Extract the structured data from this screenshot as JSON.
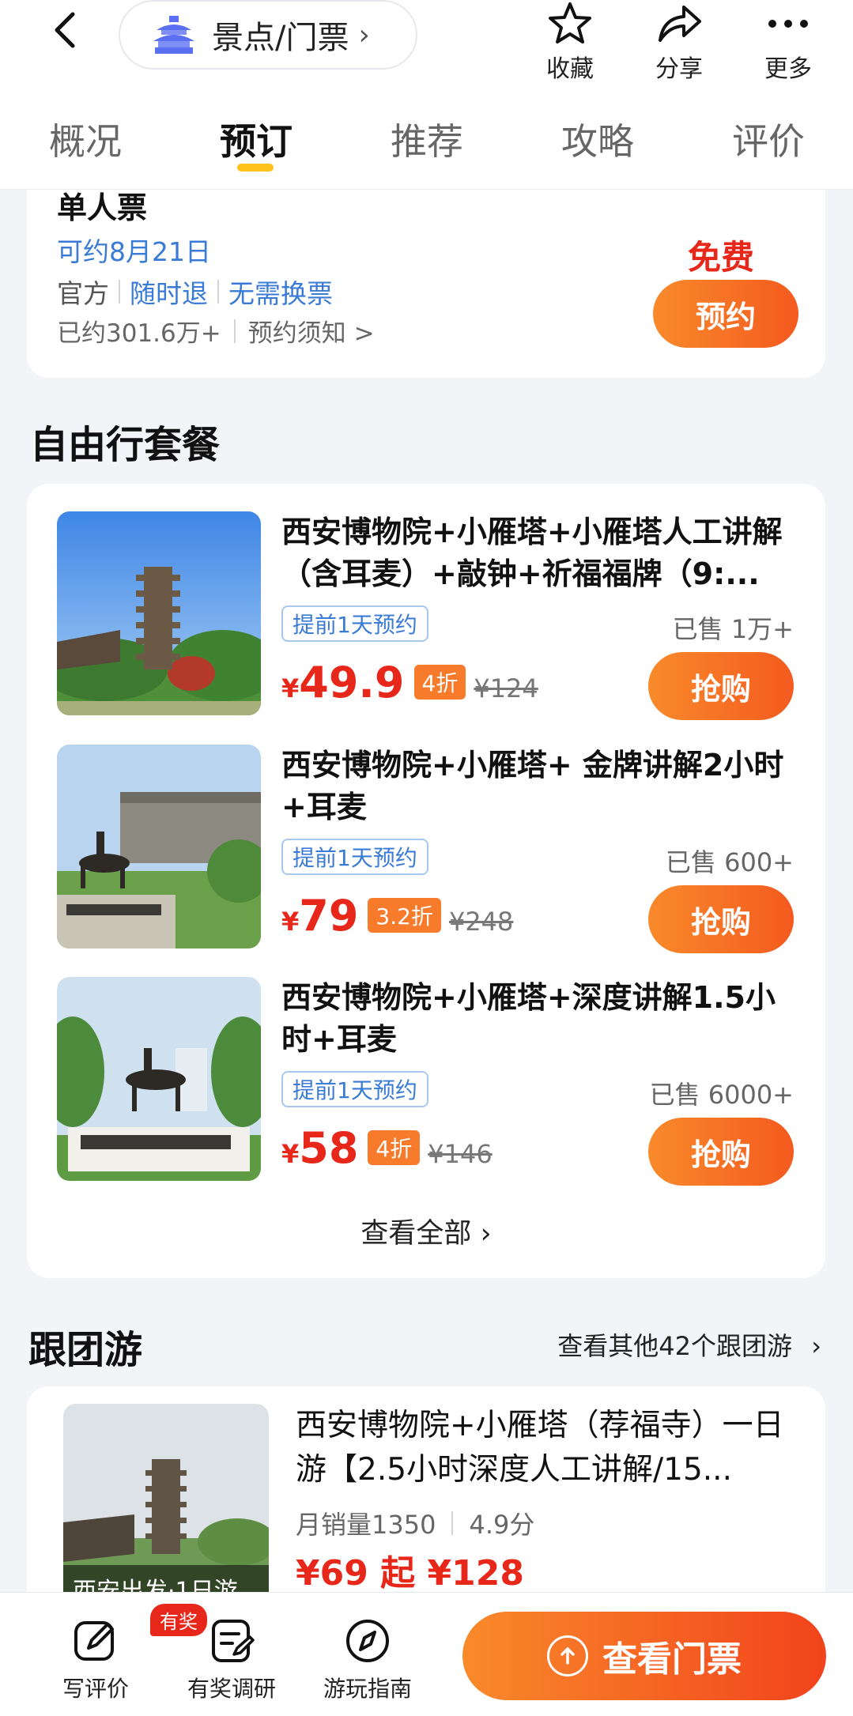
{
  "header": {
    "pill_label": "景点/门票",
    "actions": [
      {
        "label": "收藏",
        "icon": "star-icon"
      },
      {
        "label": "分享",
        "icon": "share-icon"
      },
      {
        "label": "更多",
        "icon": "more-icon"
      }
    ]
  },
  "tabs": [
    "概况",
    "预订",
    "推荐",
    "攻略",
    "评价"
  ],
  "active_tab": "预订",
  "ticket": {
    "title": "单人票",
    "date": "可约8月21日",
    "tag_official": "官方",
    "tag_refund": "随时退",
    "tag_noexchange": "无需换票",
    "booked": "已约301.6万+",
    "notice": "预约须知 >",
    "price": "免费",
    "button": "预约"
  },
  "packages_section": {
    "title": "自由行套餐",
    "items": [
      {
        "name": "西安博物院+小雁塔+小雁塔人工讲解（含耳麦）+敲钟+祈福福牌（9:...",
        "tag": "提前1天预约",
        "sold": "已售 1万+",
        "yen": "¥",
        "price": "49.9",
        "discount": "4折",
        "original": "¥124",
        "button": "抢购"
      },
      {
        "name": "西安博物院+小雁塔+ 金牌讲解2小时+耳麦",
        "tag": "提前1天预约",
        "sold": "已售 600+",
        "yen": "¥",
        "price": "79",
        "discount": "3.2折",
        "original": "¥248",
        "button": "抢购"
      },
      {
        "name": "西安博物院+小雁塔+深度讲解1.5小时+耳麦",
        "tag": "提前1天预约",
        "sold": "已售 6000+",
        "yen": "¥",
        "price": "58",
        "discount": "4折",
        "original": "¥146",
        "button": "抢购"
      }
    ],
    "see_all": "查看全部"
  },
  "group_section": {
    "title": "跟团游",
    "more": "查看其他42个跟团游",
    "item": {
      "caption": "西安出发·1日游",
      "name": "西安博物院+小雁塔（荐福寺）一日游【2.5小时深度人工讲解/15...",
      "monthly_sales": "月销量1350",
      "score": "4.9分",
      "price": "¥69 起 ¥128"
    }
  },
  "bottom_bar": {
    "actions": [
      {
        "label": "写评价",
        "icon": "edit-icon"
      },
      {
        "label": "有奖调研",
        "icon": "survey-icon"
      },
      {
        "label": "游玩指南",
        "icon": "compass-icon"
      }
    ],
    "badge": "有奖",
    "cta": "查看门票"
  },
  "colors": {
    "accent": "#f45a1f",
    "price": "#e8271b",
    "link": "#3a7bd5",
    "tab_indicator": "#ffc21a"
  }
}
